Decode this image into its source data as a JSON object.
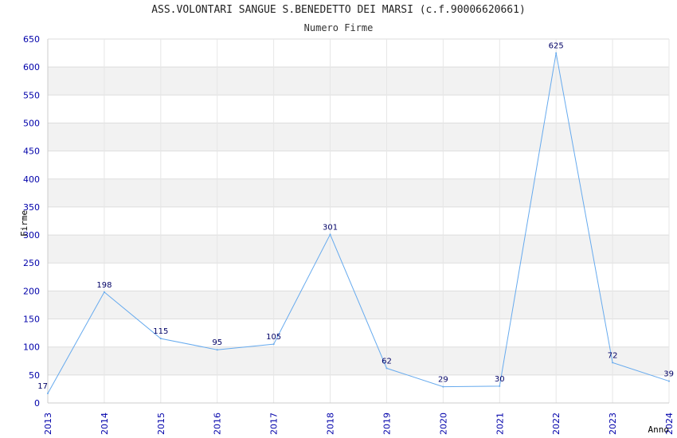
{
  "chart_data": {
    "type": "line",
    "title": "ASS.VOLONTARI SANGUE S.BENEDETTO DEI MARSI (c.f.90006620661)",
    "subtitle": "Numero Firme",
    "xlabel": "Anno",
    "ylabel": "Firme",
    "ylim": [
      0,
      650
    ],
    "yticks": [
      0,
      50,
      100,
      150,
      200,
      250,
      300,
      350,
      400,
      450,
      500,
      550,
      600,
      650
    ],
    "grid": true,
    "line_color": "#66aaee",
    "tick_color": "#0000aa",
    "band_color": "#f2f2f2",
    "categories": [
      "2013",
      "2014",
      "2015",
      "2016",
      "2017",
      "2018",
      "2019",
      "2020",
      "2021",
      "2022",
      "2023",
      "2024"
    ],
    "values": [
      17,
      198,
      115,
      95,
      105,
      301,
      62,
      29,
      30,
      625,
      72,
      39
    ]
  }
}
